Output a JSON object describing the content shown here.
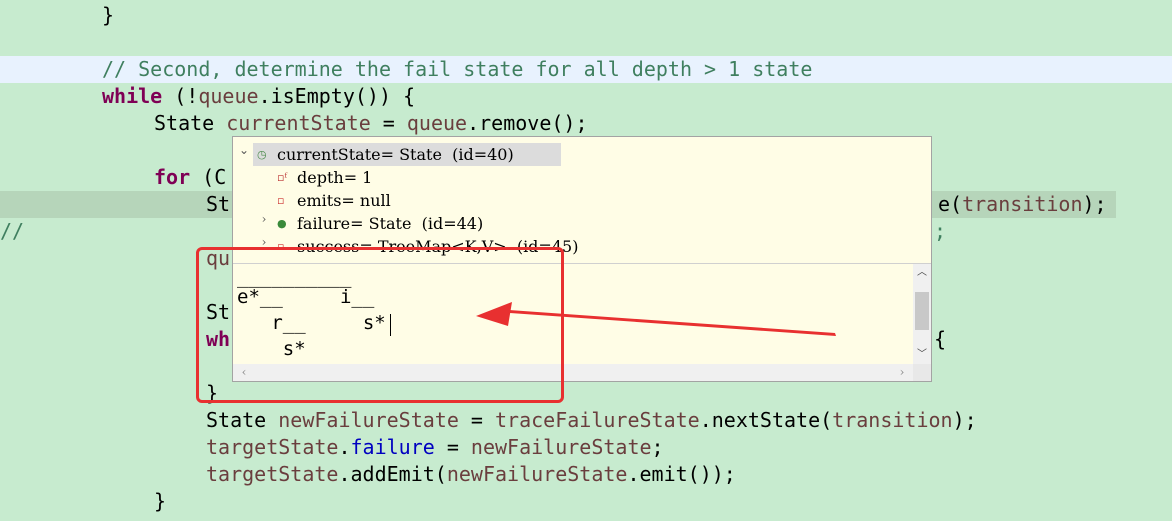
{
  "editor": {
    "code": {
      "l1": "}",
      "l3_comment": "// Second, determine the fail state for all depth > 1 state",
      "l4_kw": "while",
      "l4_a": " (!",
      "l4_var": "queue",
      "l4_b": ".isEmpty()) {",
      "l5_a": "State ",
      "l5_var": "currentState",
      "l5_b": " = ",
      "l5_var2": "queue",
      "l5_c": ".remove();",
      "l7_kw": "for",
      "l7_a": " (C",
      "l8_a": "St",
      "l8_tail_a": "e(",
      "l8_tail_var": "transition",
      "l8_tail_b": ");",
      "l9_a": "//",
      "l9_tail": ";",
      "l10_var": "qu",
      "l12_a": "St",
      "l13_kw": "wh",
      "l13_tail": "{",
      "l15": "}",
      "l16_a": "State ",
      "l16_var": "newFailureState",
      "l16_b": " = ",
      "l16_var2": "traceFailureState",
      "l16_c": ".nextState(",
      "l16_var3": "transition",
      "l16_d": ");",
      "l17_var": "targetState",
      "l17_a": ".",
      "l17_field": "failure",
      "l17_b": " = ",
      "l17_var2": "newFailureState",
      "l17_c": ";",
      "l18_var": "targetState",
      "l18_a": ".addEmit(",
      "l18_var2": "newFailureState",
      "l18_b": ".emit());",
      "l19": "}"
    }
  },
  "popup": {
    "rows": [
      {
        "text": "currentState= State  (id=40)",
        "expanded": true,
        "icon": "local-variable-icon"
      },
      {
        "text": "depth= 1",
        "icon": "final-field-icon"
      },
      {
        "text": "emits= null",
        "icon": "private-field-icon"
      },
      {
        "text": "failure= State  (id=44)",
        "icon": "package-field-icon"
      },
      {
        "text": "success= TreeMap<K,V>  (id=45)",
        "icon": "private-field-icon"
      }
    ],
    "detail": {
      "line1": "__________",
      "line2": "e*__     i__",
      "line3": "   r__     s*",
      "line4": "    s*"
    }
  },
  "colors": {
    "editor_bg": "#c7ebcf",
    "annotation": "#e83030",
    "popup_bg": "#fffde6"
  }
}
